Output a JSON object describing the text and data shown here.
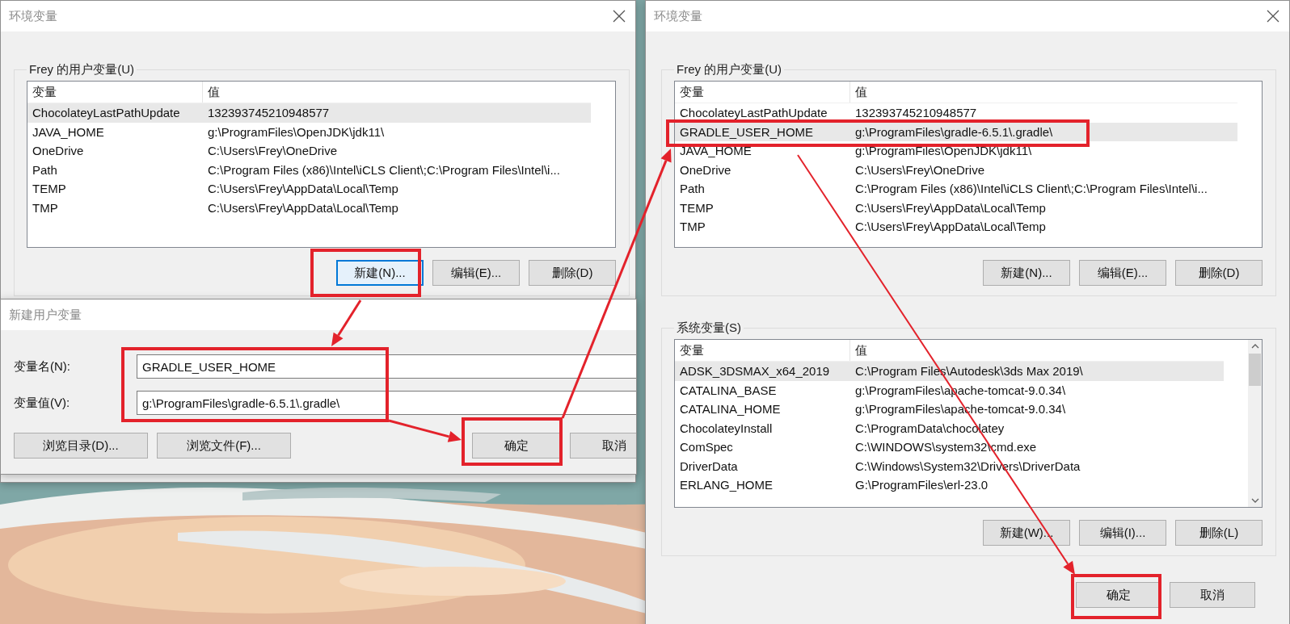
{
  "env_window_before": {
    "title": "环境变量",
    "user_vars": {
      "label": "Frey 的用户变量(U)",
      "columns": [
        "变量",
        "值"
      ],
      "rows": [
        {
          "name": "ChocolateyLastPathUpdate",
          "value": "132393745210948577",
          "selected": true
        },
        {
          "name": "JAVA_HOME",
          "value": "g:\\ProgramFiles\\OpenJDK\\jdk11\\",
          "selected": false
        },
        {
          "name": "OneDrive",
          "value": "C:\\Users\\Frey\\OneDrive",
          "selected": false
        },
        {
          "name": "Path",
          "value": "C:\\Program Files (x86)\\Intel\\iCLS Client\\;C:\\Program Files\\Intel\\i...",
          "selected": false
        },
        {
          "name": "TEMP",
          "value": "C:\\Users\\Frey\\AppData\\Local\\Temp",
          "selected": false
        },
        {
          "name": "TMP",
          "value": "C:\\Users\\Frey\\AppData\\Local\\Temp",
          "selected": false
        }
      ],
      "buttons": [
        {
          "label": "新建(N)...",
          "focused": true
        },
        {
          "label": "编辑(E)...",
          "focused": false
        },
        {
          "label": "删除(D)",
          "focused": false
        }
      ]
    }
  },
  "new_variable_dialog": {
    "title": "新建用户变量",
    "fields": [
      {
        "label": "变量名(N):",
        "value": "GRADLE_USER_HOME"
      },
      {
        "label": "变量值(V):",
        "value": "g:\\ProgramFiles\\gradle-6.5.1\\.gradle\\"
      }
    ],
    "browse_buttons": [
      "浏览目录(D)...",
      "浏览文件(F)..."
    ],
    "actions": [
      "确定",
      "取消"
    ]
  },
  "env_window_after": {
    "title": "环境变量",
    "user_vars": {
      "label": "Frey 的用户变量(U)",
      "columns": [
        "变量",
        "值"
      ],
      "rows": [
        {
          "name": "ChocolateyLastPathUpdate",
          "value": "132393745210948577",
          "selected": false
        },
        {
          "name": "GRADLE_USER_HOME",
          "value": "g:\\ProgramFiles\\gradle-6.5.1\\.gradle\\",
          "selected": true
        },
        {
          "name": "JAVA_HOME",
          "value": "g:\\ProgramFiles\\OpenJDK\\jdk11\\",
          "selected": false
        },
        {
          "name": "OneDrive",
          "value": "C:\\Users\\Frey\\OneDrive",
          "selected": false
        },
        {
          "name": "Path",
          "value": "C:\\Program Files (x86)\\Intel\\iCLS Client\\;C:\\Program Files\\Intel\\i...",
          "selected": false
        },
        {
          "name": "TEMP",
          "value": "C:\\Users\\Frey\\AppData\\Local\\Temp",
          "selected": false
        },
        {
          "name": "TMP",
          "value": "C:\\Users\\Frey\\AppData\\Local\\Temp",
          "selected": false
        }
      ],
      "buttons": [
        {
          "label": "新建(N)...",
          "focused": false
        },
        {
          "label": "编辑(E)...",
          "focused": false
        },
        {
          "label": "删除(D)",
          "focused": false
        }
      ]
    },
    "system_vars": {
      "label": "系统变量(S)",
      "columns": [
        "变量",
        "值"
      ],
      "rows": [
        {
          "name": "ADSK_3DSMAX_x64_2019",
          "value": "C:\\Program Files\\Autodesk\\3ds Max 2019\\",
          "selected": true
        },
        {
          "name": "CATALINA_BASE",
          "value": "g:\\ProgramFiles\\apache-tomcat-9.0.34\\",
          "selected": false
        },
        {
          "name": "CATALINA_HOME",
          "value": "g:\\ProgramFiles\\apache-tomcat-9.0.34\\",
          "selected": false
        },
        {
          "name": "ChocolateyInstall",
          "value": "C:\\ProgramData\\chocolatey",
          "selected": false
        },
        {
          "name": "ComSpec",
          "value": "C:\\WINDOWS\\system32\\cmd.exe",
          "selected": false
        },
        {
          "name": "DriverData",
          "value": "C:\\Windows\\System32\\Drivers\\DriverData",
          "selected": false
        },
        {
          "name": "ERLANG_HOME",
          "value": "G:\\ProgramFiles\\erl-23.0",
          "selected": false
        }
      ],
      "buttons": [
        {
          "label": "新建(W)...",
          "focused": false
        },
        {
          "label": "编辑(I)...",
          "focused": false
        },
        {
          "label": "删除(L)",
          "focused": false
        }
      ]
    },
    "actions": [
      "确定",
      "取消"
    ]
  }
}
